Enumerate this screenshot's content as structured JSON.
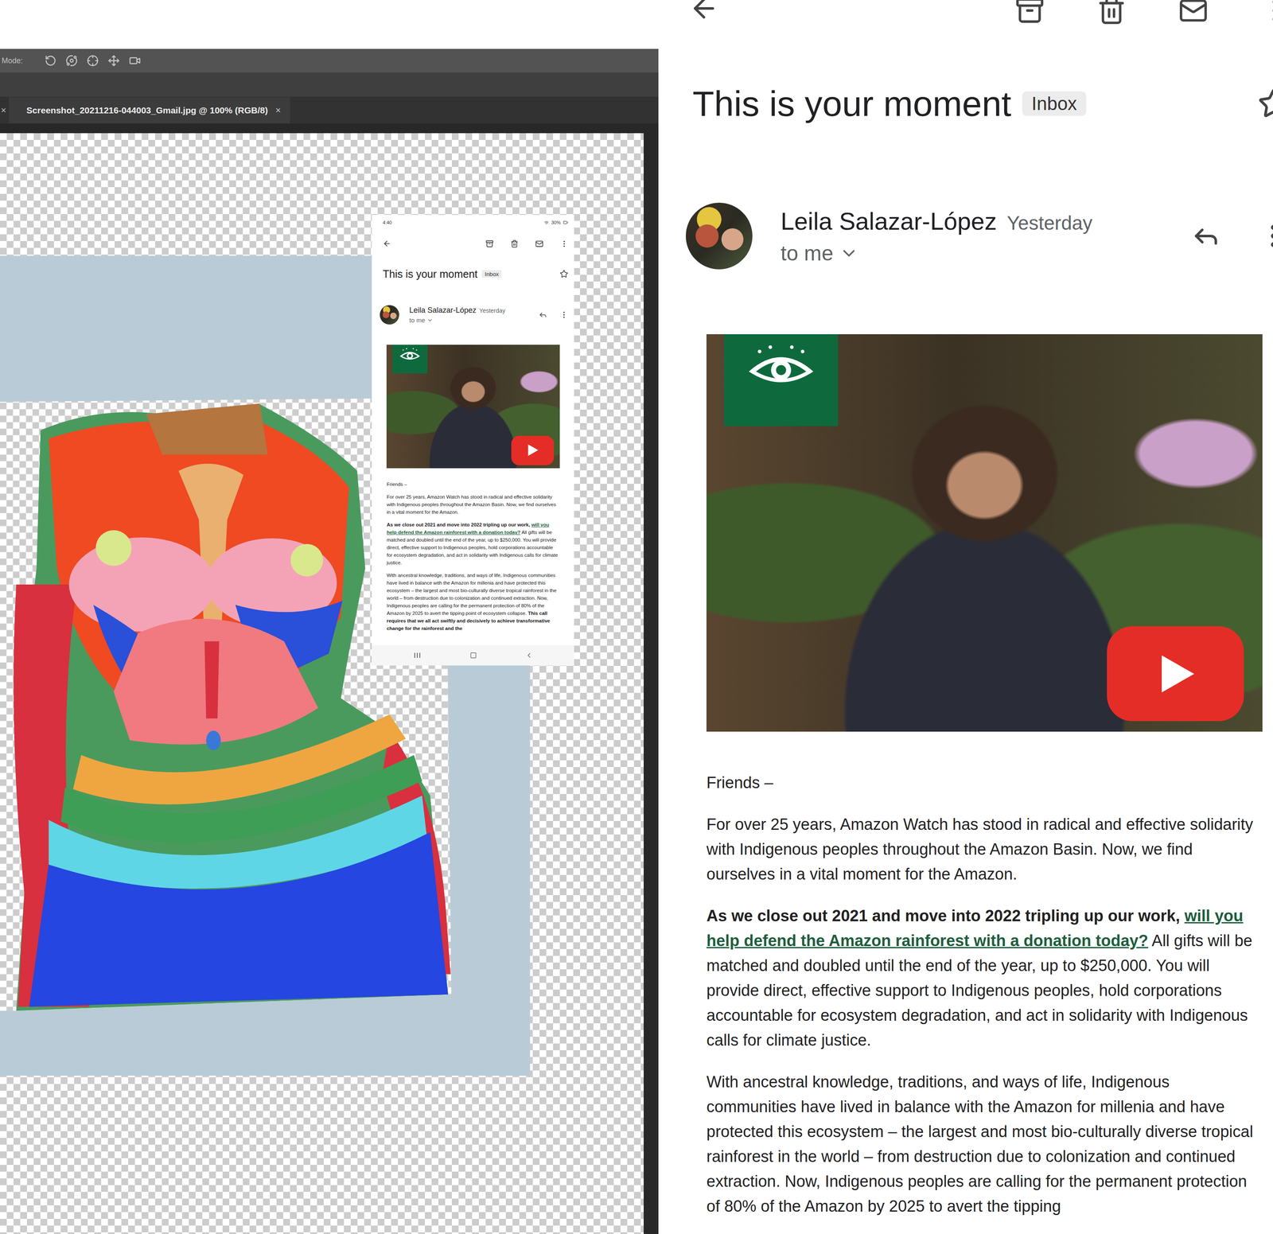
{
  "editor": {
    "prev_tab_close": "×",
    "mode_label": "Mode:",
    "tab": {
      "label": "Screenshot_20211216-044003_Gmail.jpg @ 100% (RGB/8)",
      "close": "×",
      "selected": true
    }
  },
  "mini_screenshot": {
    "status_time": "4:40",
    "status_battery": "30%",
    "subject": "This is your moment",
    "label": "Inbox",
    "sender": "Leila Salazar-López",
    "date": "Yesterday",
    "to": "to me",
    "greeting": "Friends –",
    "paragraphs": [
      [
        {
          "text": "For over 25 years, Amazon Watch has stood in radical and effective solidarity with Indigenous peoples throughout the Amazon Basin. Now, we find ourselves in a vital moment for the Amazon.",
          "bold": false,
          "link": false
        }
      ],
      [
        {
          "text": "As we close out 2021 and move into 2022 tripling up our work, ",
          "bold": true,
          "link": false
        },
        {
          "text": "will you help defend the Amazon rainforest with a donation today?",
          "bold": true,
          "link": true
        },
        {
          "text": " All gifts will be matched and doubled until the end of the year, up to $250,000. You will provide direct, effective support to Indigenous peoples, hold corporations accountable for ecosystem degradation, and act in solidarity with Indigenous calls for climate justice.",
          "bold": false,
          "link": false
        }
      ],
      [
        {
          "text": "With ancestral knowledge, traditions, and ways of life, Indigenous communities have lived in balance with the Amazon for millenia and have protected this ecosystem – the largest and most bio-culturally diverse tropical rainforest in the world – from destruction due to colonization and continued extraction. Now, Indigenous peoples are calling for the permanent protection of 80% of the Amazon by 2025 to avert the tipping point of ecosystem collapse. ",
          "bold": false,
          "link": false
        },
        {
          "text": "This call requires that we all act swiftly and decisively to achieve transformative change for the rainforest and the",
          "bold": true,
          "link": false
        }
      ]
    ]
  },
  "email": {
    "subject": "This is your moment",
    "label": "Inbox",
    "sender": "Leila Salazar-López",
    "date": "Yesterday",
    "to": "to me",
    "greeting": "Friends –",
    "paragraphs": [
      [
        {
          "text": "For over 25 years, Amazon Watch has stood in radical and effective solidarity with Indigenous peoples throughout the Amazon Basin. Now, we find ourselves in a vital moment for the Amazon.",
          "bold": false,
          "link": false
        }
      ],
      [
        {
          "text": "As we close out 2021 and move into 2022 tripling up our work, ",
          "bold": true,
          "link": false
        },
        {
          "text": "will you help defend the Amazon rainforest with a donation today?",
          "bold": true,
          "link": true
        },
        {
          "text": " All gifts will be matched and doubled until the end of the year, up to $250,000. You will provide direct, effective support to Indigenous peoples, hold corporations accountable for ecosystem degradation, and act in solidarity with Indigenous calls for climate justice.",
          "bold": false,
          "link": false
        }
      ],
      [
        {
          "text": "With ancestral knowledge, traditions, and ways of life, Indigenous communities have lived in balance with the Amazon for millenia and have protected this ecosystem – the largest and most bio-culturally diverse tropical rainforest in the world – from destruction due to colonization and continued extraction. Now, Indigenous peoples are calling for the permanent protection of 80% of the Amazon by 2025 to avert the tipping",
          "bold": false,
          "link": false
        }
      ]
    ]
  }
}
